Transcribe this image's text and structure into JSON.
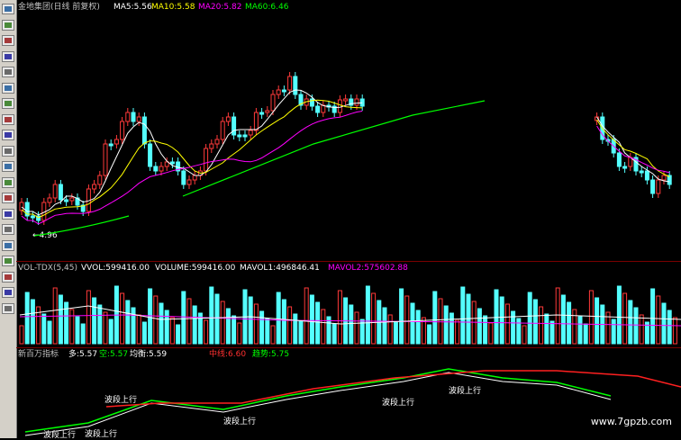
{
  "header": {
    "title": "金地集团(日线 前复权)",
    "ma": [
      {
        "label": "MA5:5.56",
        "color": "#ffffff"
      },
      {
        "label": "MA10:5.58",
        "color": "#ffff00"
      },
      {
        "label": "MA20:5.82",
        "color": "#ff00ff"
      },
      {
        "label": "MA60:6.46",
        "color": "#00ff00"
      }
    ]
  },
  "price": {
    "low_marker": "←4.96"
  },
  "volume_header": {
    "name": "VOL-TDX(5,45)",
    "vvol": "VVOL:599416.00",
    "volume": "VOLUME:599416.00",
    "mavol1": "MAVOL1:496846.41",
    "mavol2": "MAVOL2:575602.88"
  },
  "indicator_header": {
    "name": "新百万指标",
    "duo": "多:5.57",
    "kong": "空:5.57",
    "junxian": "均衡:5.59",
    "zhongxian": "中线:6.60",
    "qushi": "趋势:5.75"
  },
  "signals": [
    "波段上行",
    "波段上行",
    "波段上行",
    "波段上行",
    "波段上行",
    "波段上行"
  ],
  "watermark": "www.7gpzb.com",
  "toolbar_icons": [
    "chart-icon",
    "line-icon",
    "candle-icon",
    "grid-icon",
    "table-icon",
    "list-icon",
    "window-icon",
    "info-icon",
    "book-icon",
    "calc-icon",
    "doc-icon",
    "tile-icon",
    "stack-icon",
    "bars-icon",
    "screen-icon",
    "layout-icon",
    "zoom-icon",
    "move-icon",
    "up-arrow-icon",
    "down-arrow-icon"
  ],
  "colors": {
    "up": "#ff3a3a",
    "down": "#54ffff",
    "ma5": "#ffffff",
    "ma10": "#ffff00",
    "ma20": "#ff00ff",
    "ma60": "#00ff00",
    "divider": "#7a0000",
    "signal_green": "#00ff00",
    "signal_red": "#ff2020"
  }
}
